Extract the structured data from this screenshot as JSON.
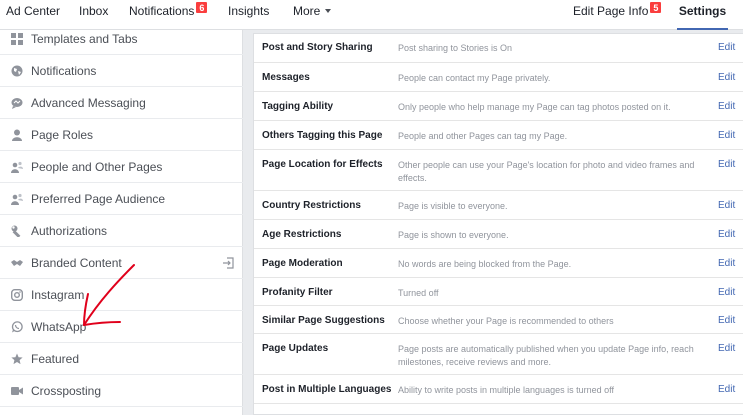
{
  "topnav": {
    "ad_center": "Ad Center",
    "inbox": "Inbox",
    "notifications": "Notifications",
    "notifications_badge": "6",
    "insights": "Insights",
    "more": "More",
    "edit_page_info": "Edit Page Info",
    "edit_page_info_badge": "5",
    "settings": "Settings"
  },
  "sidebar": {
    "items": [
      {
        "label": "Templates and Tabs",
        "icon": "grid-icon"
      },
      {
        "label": "Notifications",
        "icon": "globe-icon"
      },
      {
        "label": "Advanced Messaging",
        "icon": "chat-bubble-icon"
      },
      {
        "label": "Page Roles",
        "icon": "person-icon"
      },
      {
        "label": "People and Other Pages",
        "icon": "people-icon"
      },
      {
        "label": "Preferred Page Audience",
        "icon": "people-icon"
      },
      {
        "label": "Authorizations",
        "icon": "wrench-icon"
      },
      {
        "label": "Branded Content",
        "icon": "handshake-icon"
      },
      {
        "label": "Instagram",
        "icon": "instagram-icon"
      },
      {
        "label": "WhatsApp",
        "icon": "whatsapp-icon"
      },
      {
        "label": "Featured",
        "icon": "star-icon"
      },
      {
        "label": "Crossposting",
        "icon": "video-icon"
      }
    ]
  },
  "settings": {
    "edit_label": "Edit",
    "rows": [
      {
        "name": "Post and Story Sharing",
        "desc": "Post sharing to Stories is On"
      },
      {
        "name": "Messages",
        "desc": "People can contact my Page privately."
      },
      {
        "name": "Tagging Ability",
        "desc": "Only people who help manage my Page can tag photos posted on it."
      },
      {
        "name": "Others Tagging this Page",
        "desc": "People and other Pages can tag my Page."
      },
      {
        "name": "Page Location for Effects",
        "desc": "Other people can use your Page's location for photo and video frames and effects."
      },
      {
        "name": "Country Restrictions",
        "desc": "Page is visible to everyone."
      },
      {
        "name": "Age Restrictions",
        "desc": "Page is shown to everyone."
      },
      {
        "name": "Page Moderation",
        "desc": "No words are being blocked from the Page."
      },
      {
        "name": "Profanity Filter",
        "desc": "Turned off"
      },
      {
        "name": "Similar Page Suggestions",
        "desc": "Choose whether your Page is recommended to others"
      },
      {
        "name": "Page Updates",
        "desc": "Page posts are automatically published when you update Page info, reach milestones, receive reviews and more."
      },
      {
        "name": "Post in Multiple Languages",
        "desc": "Ability to write posts in multiple languages is turned off"
      }
    ]
  },
  "colors": {
    "accent": "#4267b2",
    "badge": "#fa3e3e",
    "annotation": "#e0001b"
  }
}
